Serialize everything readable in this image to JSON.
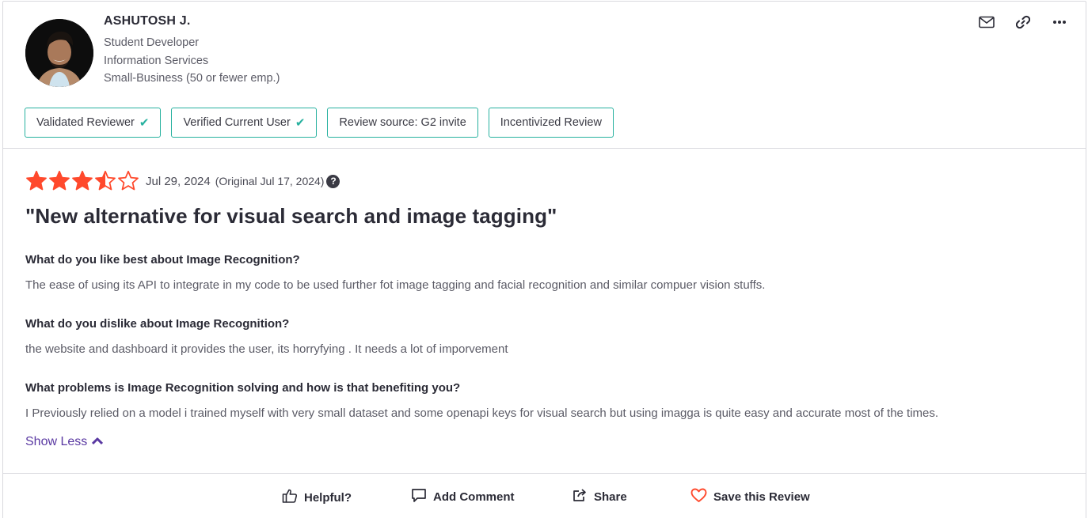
{
  "reviewer": {
    "name": "ASHUTOSH J.",
    "role": "Student Developer",
    "industry": "Information Services",
    "company_size": "Small-Business (50 or fewer emp.)"
  },
  "header_icons": [
    "mail-icon",
    "link-icon",
    "more-icon"
  ],
  "badges": [
    {
      "label": "Validated Reviewer",
      "checked": true
    },
    {
      "label": "Verified Current User",
      "checked": true
    },
    {
      "label": "Review source: G2 invite",
      "checked": false
    },
    {
      "label": "Incentivized Review",
      "checked": false
    }
  ],
  "review": {
    "rating": 3.5,
    "rating_max": 5,
    "date": "Jul 29, 2024",
    "original_date": "(Original Jul 17, 2024)",
    "help_glyph": "?",
    "title": "\"New alternative for visual search and image tagging\"",
    "qa": [
      {
        "question": "What do you like best about Image Recognition?",
        "answer": "The ease of using its API to integrate in my code to be used further fot image tagging and facial recognition and similar compuer vision stuffs."
      },
      {
        "question": "What do you dislike about Image Recognition?",
        "answer": "the website and dashboard it provides the user, its horryfying . It needs a lot of imporvement"
      },
      {
        "question": "What problems is Image Recognition solving and how is that benefiting you?",
        "answer": "I Previously relied on a model i trained myself with very small dataset and some openapi keys for visual search but using imagga is quite easy and accurate most of the times."
      }
    ],
    "show_less_label": "Show Less"
  },
  "actions": {
    "helpful": "Helpful?",
    "comment": "Add Comment",
    "share": "Share",
    "save": "Save this Review"
  },
  "colors": {
    "star": "#ff492c",
    "badge_border": "#27b19f",
    "link": "#5a39a2",
    "heart": "#ff492c"
  }
}
